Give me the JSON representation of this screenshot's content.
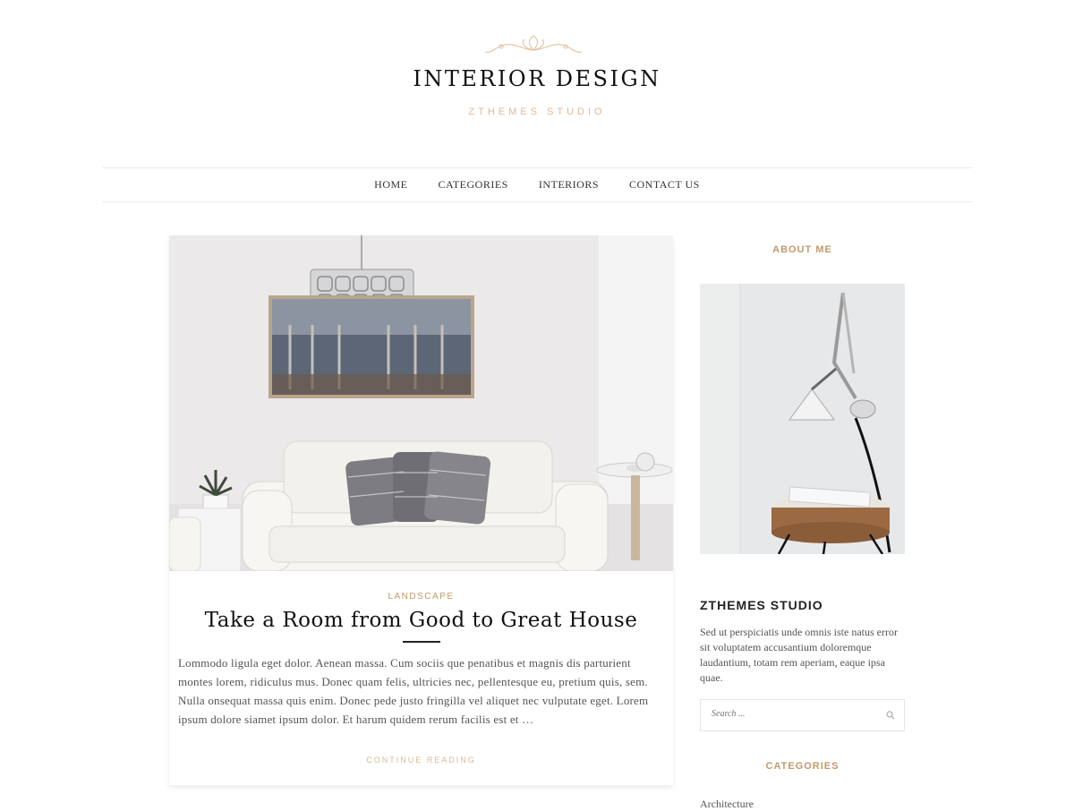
{
  "header": {
    "title": "INTERIOR DESIGN",
    "tagline": "ZTHEMES STUDIO",
    "ornament_icon": "flourish-icon",
    "accent_color": "#c19a6b"
  },
  "nav": {
    "items": [
      "HOME",
      "CATEGORIES",
      "INTERIORS",
      "CONTACT US"
    ]
  },
  "post": {
    "category": "LANDSCAPE",
    "title": "Take a Room from Good to Great House",
    "excerpt": "Lommodo ligula eget dolor. Aenean massa. Cum sociis que penatibus et magnis dis parturient montes lorem, ridiculus mus. Donec quam felis, ultricies nec, pellentesque eu, pretium quis, sem. Nulla onsequat massa quis enim. Donec pede justo fringilla vel aliquet nec vulputate eget. Lorem ipsum dolore siamet ipsum dolor. Et harum quidem rerum facilis est et …",
    "read_more": "CONTINUE READING"
  },
  "sidebar": {
    "about_title": "ABOUT ME",
    "studio_title": "ZTHEMES STUDIO",
    "studio_text": "Sed ut perspiciatis unde omnis iste natus error sit voluptatem accusantium doloremque laudantium, totam rem aperiam, eaque ipsa quae.",
    "search_placeholder": "Search ...",
    "categories_title": "CATEGORIES",
    "categories": [
      "Architecture"
    ]
  }
}
